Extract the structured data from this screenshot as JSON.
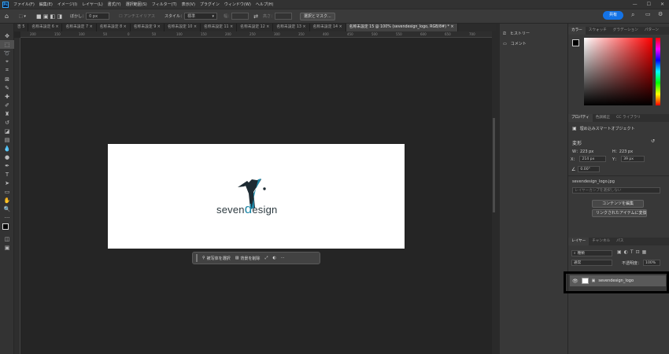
{
  "app": {
    "logo": "Ps",
    "minimize": "—",
    "maximize": "☐",
    "close": "✕"
  },
  "menu": [
    "ファイル(F)",
    "編集(E)",
    "イメージ(I)",
    "レイヤー(L)",
    "書式(Y)",
    "選択範囲(S)",
    "フィルター(T)",
    "表示(V)",
    "プラグイン",
    "ウィンドウ(W)",
    "ヘルプ(H)"
  ],
  "options": {
    "feather_label": "ぼかし：",
    "feather_value": "0 px",
    "antialias": "アンチエイリアス",
    "style_label": "スタイル：",
    "style_value": "標準",
    "width_label": "幅：",
    "height_label": "高さ：",
    "select_mask": "選択とマスク...",
    "share": "共有"
  },
  "tabs": [
    "否 5",
    "名称未設定 6",
    "名称未設定 7",
    "名称未設定 8",
    "名称未設定 9",
    "名称未設定 10",
    "名称未設定 11",
    "名称未設定 12",
    "名称未設定 13",
    "名称未設定 14",
    "名称未設定 15 @ 100% (sevendesign_logo, RGB/8#) *"
  ],
  "ruler_ticks": [
    "200",
    "150",
    "100",
    "50",
    "0",
    "50",
    "100",
    "150",
    "200",
    "250",
    "300",
    "350",
    "400",
    "450",
    "500",
    "550",
    "600",
    "650",
    "700",
    "750"
  ],
  "canvas": {
    "logo_text_left": "seven",
    "logo_text_d": "d",
    "logo_text_right": "esign",
    "logo_seven_mark": "7"
  },
  "taskbar": {
    "select_subject": "被写体を選択",
    "remove_bg": "背景を削除",
    "more": "···"
  },
  "history_panel": {
    "history": "ヒストリー",
    "comments": "コメント"
  },
  "color_panel": {
    "tabs": [
      "カラー",
      "スウォッチ",
      "グラデーション",
      "パターン"
    ]
  },
  "properties": {
    "tabs": [
      "プロパティ",
      "色調補正",
      "CC ライブラリ"
    ],
    "type": "埋め込みスマートオブジェクト",
    "transform": "変形",
    "w_label": "W：",
    "w_value": "223 px",
    "h_label": "H：",
    "h_value": "223 px",
    "x_label": "X：",
    "x_value": "214 px",
    "y_label": "Y：",
    "y_value": "39 px",
    "angle": "0.00°",
    "filename": "sevendesign_logo.jpg",
    "layercomp": "レイヤーカンプを選択しない",
    "edit_contents": "コンテンツを編集",
    "convert_linked": "リンクされたアイテムに変換..."
  },
  "layers_panel": {
    "tabs": [
      "レイヤー",
      "チャンネル",
      "パス"
    ],
    "filter": "種類",
    "blend": "通常",
    "opacity_label": "不透明度：",
    "opacity_value": "100%",
    "layer_name": "sevendesign_logo"
  },
  "colors": {
    "brand_teal": "#1f88a8",
    "accent_blue": "#1473e6"
  }
}
